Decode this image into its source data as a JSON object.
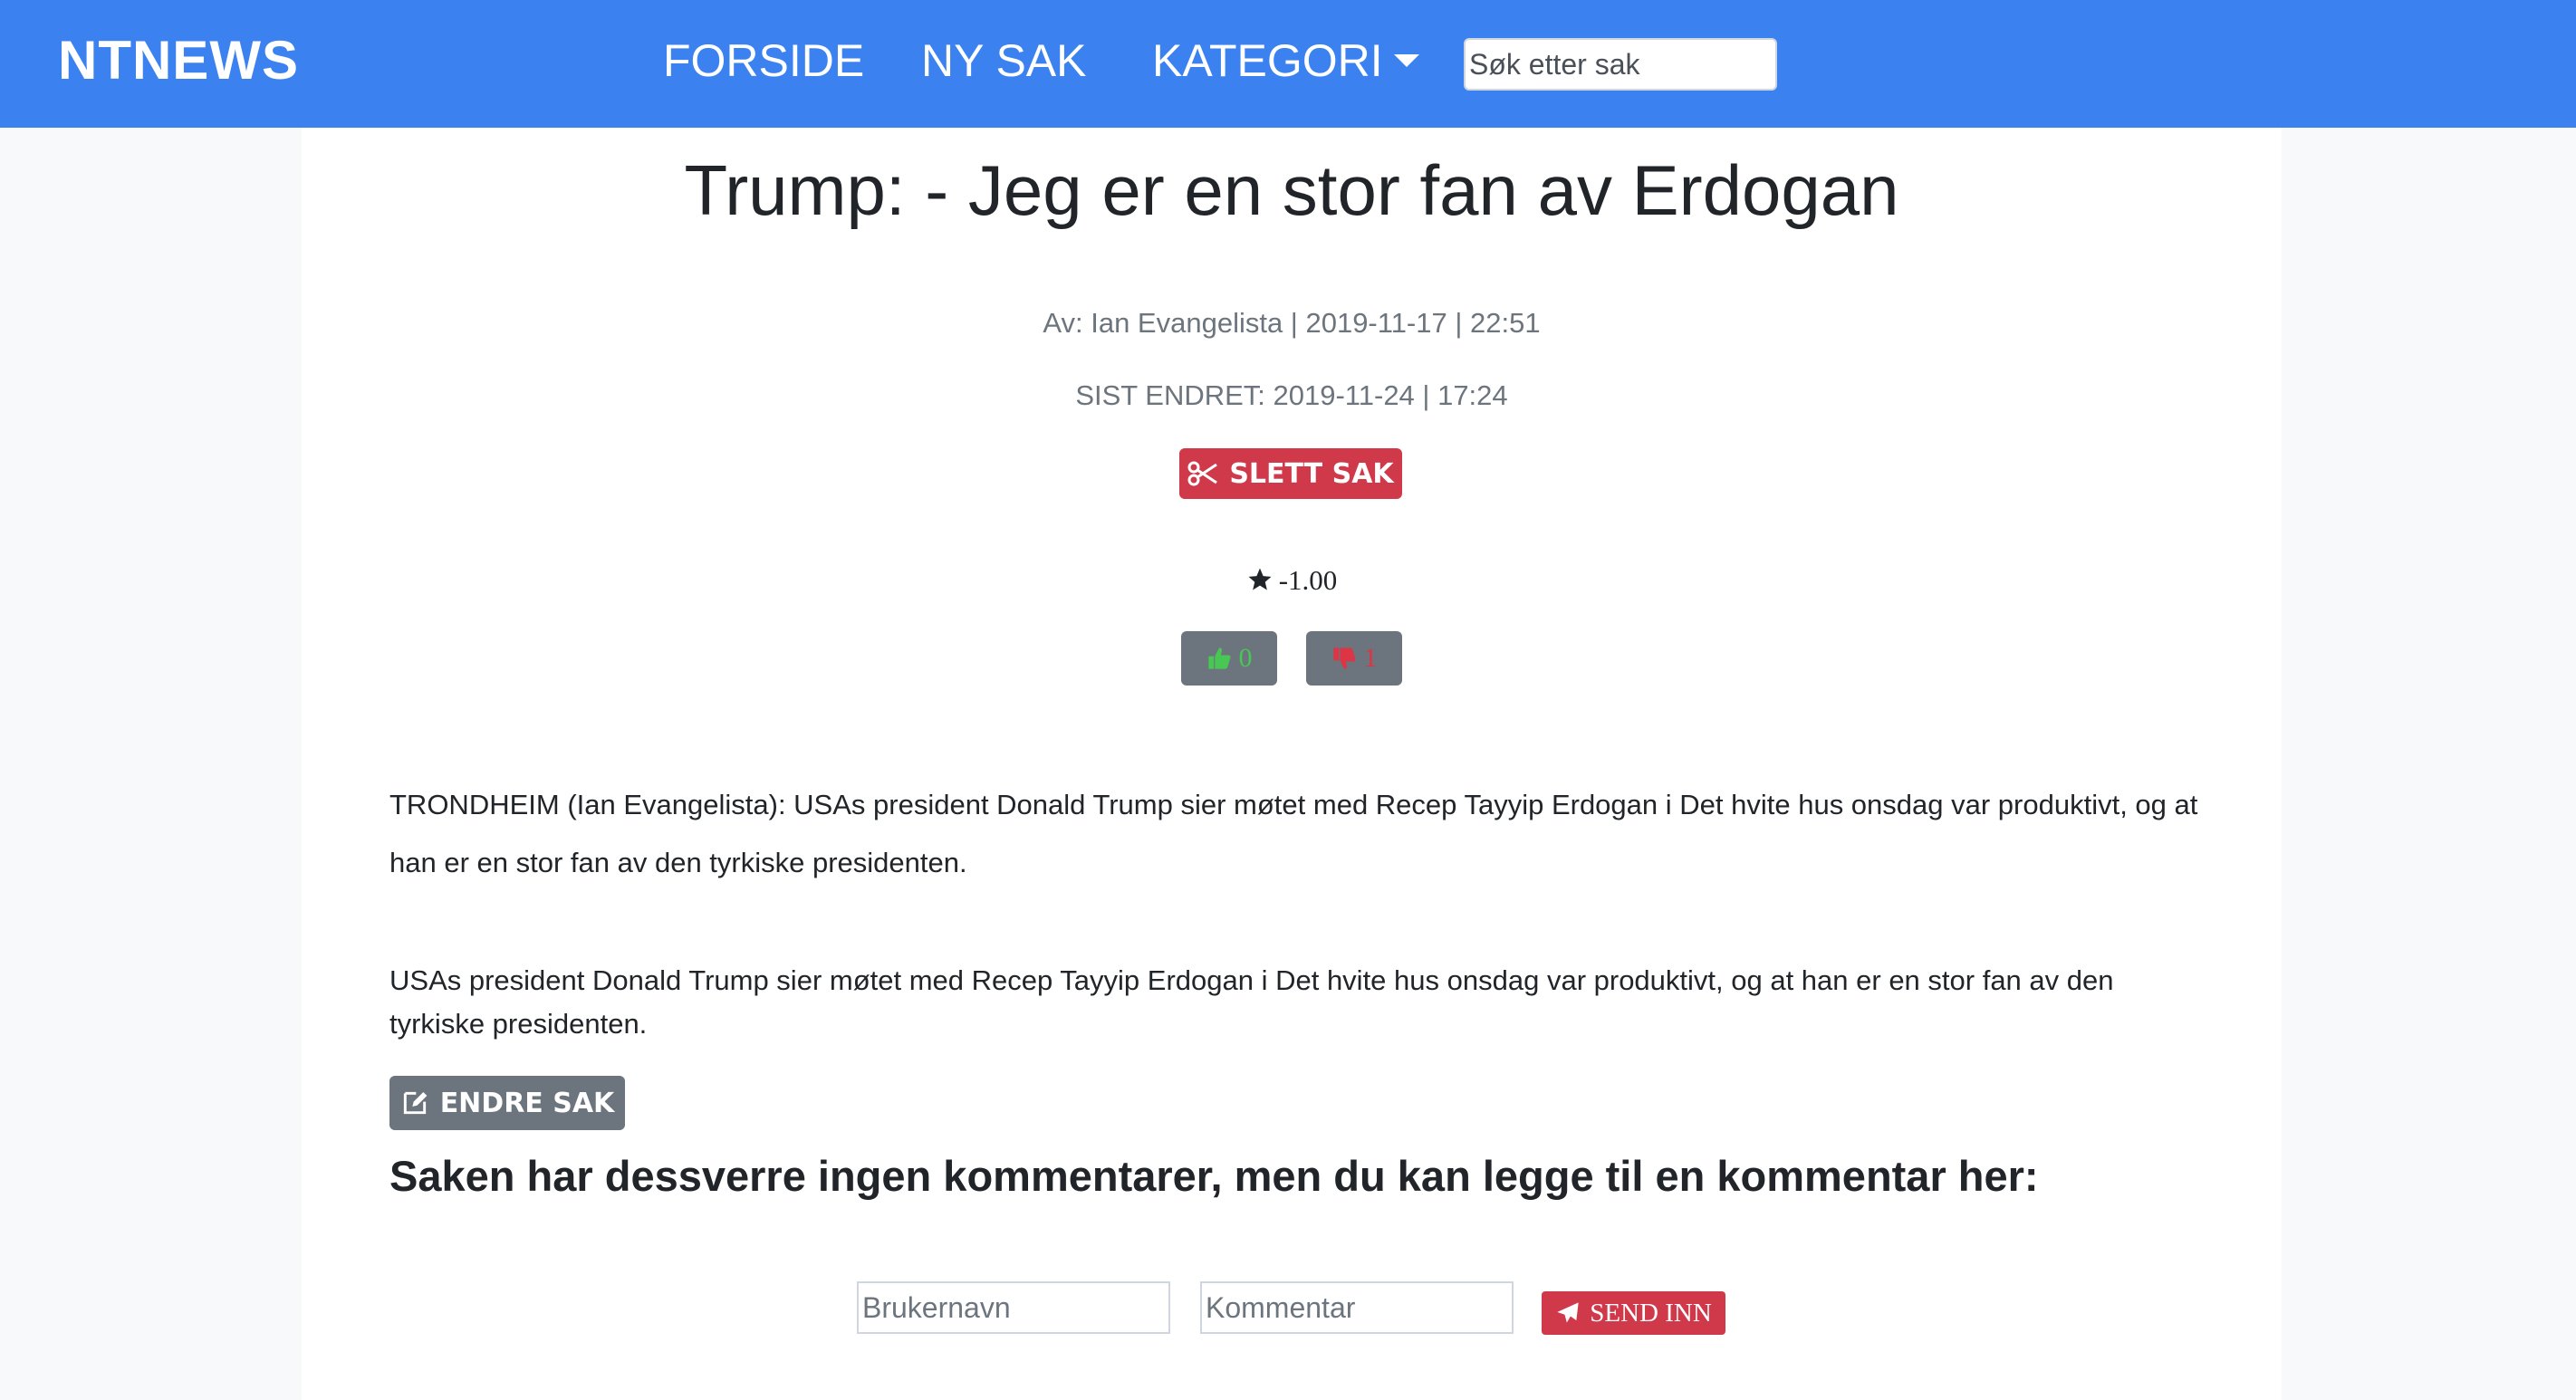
{
  "navbar": {
    "brand": "NTNEWS",
    "links": [
      "FORSIDE",
      "NY SAK",
      "KATEGORI"
    ],
    "search_placeholder": "Søk etter sak",
    "color": "#3b82f0"
  },
  "article": {
    "title": "Trump: - Jeg er en stor fan av Erdogan",
    "author_line": "Av: Ian Evangelista | 2019-11-17 | 22:51",
    "edited_line": "SIST ENDRET: 2019-11-24 | 17:24",
    "delete_label": "SLETT SAK",
    "rating": "-1.00",
    "likes": "0",
    "dislikes": "1",
    "lead": "TRONDHEIM (Ian Evangelista): USAs president Donald Trump sier møtet med Recep Tayyip Erdogan i Det hvite hus onsdag var produktivt, og at han er en stor fan av den tyrkiske presidenten.",
    "body": "USAs president Donald Trump sier møtet med Recep Tayyip Erdogan i Det hvite hus onsdag var produktivt, og at han er en stor fan av den tyrkiske presidenten.",
    "edit_label": "ENDRE SAK"
  },
  "comments": {
    "heading": "Saken har dessverre ingen kommentarer, men du kan legge til en kommentar her:",
    "username_placeholder": "Brukernavn",
    "comment_placeholder": "Kommentar",
    "submit_label": "SEND INN"
  },
  "icons": [
    "scissors-icon",
    "star-icon",
    "thumbs-up-icon",
    "thumbs-down-icon",
    "edit-icon",
    "paper-plane-icon",
    "caret-down-icon"
  ],
  "colors": {
    "danger": "#d0394a",
    "secondary": "#6c757d",
    "success": "#48c754"
  }
}
